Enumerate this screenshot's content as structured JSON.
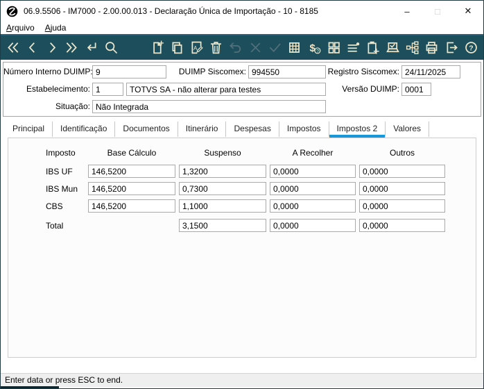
{
  "window": {
    "title": "06.9.5506 - IM7000 - 2.00.00.013 - Declaração Única de Importação - 10 - 8185",
    "controls": [
      {
        "name": "minimize",
        "glyph": "–",
        "enabled": true
      },
      {
        "name": "maximize",
        "glyph": "□",
        "enabled": false
      },
      {
        "name": "close",
        "glyph": "✕",
        "enabled": true
      }
    ]
  },
  "menu": {
    "items": [
      {
        "label": "Arquivo"
      },
      {
        "label": "Ajuda"
      }
    ]
  },
  "toolbar": {
    "icons": [
      {
        "name": "first-record",
        "enabled": true
      },
      {
        "name": "previous-record",
        "enabled": true
      },
      {
        "name": "next-record",
        "enabled": true
      },
      {
        "name": "last-record",
        "enabled": true
      },
      {
        "name": "enter-return",
        "enabled": true
      },
      {
        "name": "search",
        "enabled": true
      },
      {
        "name": "spacer"
      },
      {
        "name": "new-document",
        "enabled": true
      },
      {
        "name": "copy-document",
        "enabled": true
      },
      {
        "name": "edit-document",
        "enabled": true
      },
      {
        "name": "delete-trash",
        "enabled": true
      },
      {
        "name": "undo",
        "enabled": false
      },
      {
        "name": "cancel-x",
        "enabled": false
      },
      {
        "name": "confirm-check",
        "enabled": false
      },
      {
        "name": "table-grid",
        "enabled": true
      },
      {
        "name": "currency-query",
        "enabled": true
      },
      {
        "name": "modules-grid",
        "enabled": true
      },
      {
        "name": "list-details",
        "enabled": true
      },
      {
        "name": "clipboard-add",
        "enabled": true
      },
      {
        "name": "monitor-check",
        "enabled": true
      },
      {
        "name": "org-tree",
        "enabled": true
      },
      {
        "name": "print",
        "enabled": true
      },
      {
        "name": "exit",
        "enabled": true
      },
      {
        "name": "help",
        "enabled": true
      }
    ]
  },
  "form": {
    "numero_interno": {
      "label": "Número Interno DUIMP:",
      "value": "9"
    },
    "duimp_siscomex": {
      "label": "DUIMP Siscomex:",
      "value": "994550"
    },
    "registro_siscomex": {
      "label": "Registro Siscomex:",
      "value": "24/11/2025"
    },
    "estabelecimento": {
      "label": "Estabelecimento:",
      "value": "1",
      "description": "TOTVS SA - não alterar para testes"
    },
    "versao_duimp": {
      "label": "Versão DUIMP:",
      "value": "0001"
    },
    "situacao": {
      "label": "Situação:",
      "value": "Não Integrada"
    }
  },
  "tabs": {
    "active_index": 6,
    "items": [
      "Principal",
      "Identificação",
      "Documentos",
      "Itinerário",
      "Despesas",
      "Impostos",
      "Impostos 2",
      "Valores"
    ]
  },
  "tax_table": {
    "headers": [
      "Imposto",
      "Base Cálculo",
      "Suspenso",
      "A Recolher",
      "Outros"
    ],
    "rows": [
      {
        "label": "IBS UF",
        "base": "146,5200",
        "suspenso": "1,3200",
        "a_recolher": "0,0000",
        "outros": "0,0000"
      },
      {
        "label": "IBS Mun",
        "base": "146,5200",
        "suspenso": "0,7300",
        "a_recolher": "0,0000",
        "outros": "0,0000"
      },
      {
        "label": "CBS",
        "base": "146,5200",
        "suspenso": "1,1000",
        "a_recolher": "0,0000",
        "outros": "0,0000"
      }
    ],
    "total": {
      "label": "Total",
      "base": null,
      "suspenso": "3,1500",
      "a_recolher": "0,0000",
      "outros": "0,0000"
    }
  },
  "status_bar": {
    "message": "Enter data or press ESC to end."
  },
  "colors": {
    "toolbar_bg": "#1d4e5b",
    "icon": "#ece6cd",
    "icon_disabled": "#51707b",
    "tab_accent": "#1798da",
    "status_bg": "#efefef"
  }
}
